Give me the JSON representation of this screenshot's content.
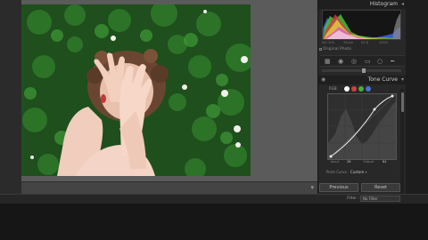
{
  "right_panel": {
    "histogram": {
      "title": "Histogram",
      "info": [
        "ISO 200",
        "35mm",
        "f/2.8",
        "1/500"
      ],
      "original_photo_label": "Original Photo"
    },
    "tone_curve": {
      "title": "Tone Curve",
      "channel_label": "RGB",
      "values": [
        {
          "label": "Input",
          "value": "28"
        },
        {
          "label": "Output",
          "value": "84"
        }
      ],
      "point_curve_label": "Point Curve :",
      "point_curve_value": "Custom"
    }
  },
  "buttons": {
    "previous": "Previous",
    "reset": "Reset"
  },
  "filmstrip": {
    "filter_label": "Filter :",
    "filter_value": "No Filter"
  },
  "colors": {
    "panel_bg": "#282828",
    "canvas_bg": "#5b5b5b",
    "curve_line": "#e8e8e8",
    "channel_red": "#d04040",
    "channel_green": "#40b040",
    "channel_blue": "#4a6fd0"
  },
  "icons": [
    "crop-icon",
    "spot-removal-icon",
    "red-eye-icon",
    "graduated-filter-icon",
    "radial-filter-icon",
    "adjustment-brush-icon"
  ]
}
